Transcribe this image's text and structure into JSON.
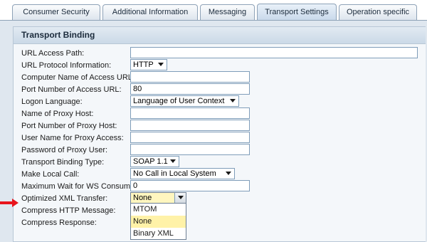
{
  "tabs": [
    {
      "label": "Consumer Security",
      "active": false
    },
    {
      "label": "Additional Information",
      "active": false
    },
    {
      "label": "Messaging",
      "active": false
    },
    {
      "label": "Transport Settings",
      "active": true
    },
    {
      "label": "Operation specific",
      "active": false
    }
  ],
  "group": {
    "title": "Transport Binding"
  },
  "fields": {
    "url_access_path": {
      "label": "URL Access Path:",
      "value": ""
    },
    "url_protocol": {
      "label": "URL Protocol Information:",
      "value": "HTTP"
    },
    "computer_name": {
      "label": "Computer Name of Access URL:",
      "value": ""
    },
    "port_number": {
      "label": "Port Number of Access URL:",
      "value": "80"
    },
    "logon_language": {
      "label": "Logon Language:",
      "value": "Language of User Context"
    },
    "proxy_host": {
      "label": "Name of Proxy Host:",
      "value": ""
    },
    "proxy_port": {
      "label": "Port Number of Proxy Host:",
      "value": ""
    },
    "proxy_user": {
      "label": "User Name for Proxy Access:",
      "value": ""
    },
    "proxy_password": {
      "label": "Password of Proxy User:",
      "value": ""
    },
    "binding_type": {
      "label": "Transport Binding Type:",
      "value": "SOAP 1.1"
    },
    "local_call": {
      "label": "Make Local Call:",
      "value": "No Call in Local System"
    },
    "max_wait": {
      "label": "Maximum Wait for WS Consumer:",
      "value": "0"
    },
    "optimized_xml": {
      "label": "Optimized XML Transfer:",
      "value": "None"
    },
    "compress_http": {
      "label": "Compress HTTP Message:"
    },
    "compress_response": {
      "label": "Compress Response:"
    }
  },
  "dropdown": {
    "options": [
      "MTOM",
      "None",
      "Binary XML"
    ],
    "highlighted": "None"
  },
  "colors": {
    "pointer_arrow": "#e8141c",
    "highlight": "#fff2a8"
  }
}
